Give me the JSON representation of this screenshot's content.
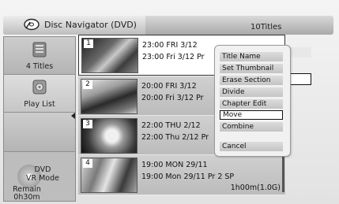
{
  "header": {
    "title": "Disc Navigator (DVD)",
    "count": "10Titles"
  },
  "nav": {
    "titles_label": "4 Titles",
    "playlist_label": "Play List",
    "disc_type": "DVD\nVR Mode",
    "remain_label": "Remain",
    "remain_value": "0h30m"
  },
  "titles": [
    {
      "num": "1",
      "line1": "23:00 FRI 3/12",
      "line2": "23:00 Fri 3/12 Pr",
      "line3": ""
    },
    {
      "num": "2",
      "line1": "20:00 FRI 3/12",
      "line2": "20:00 Fri 3/12 Pr",
      "line3": ""
    },
    {
      "num": "3",
      "line1": "22:00 THU 2/12",
      "line2": "22:00 Thu 2/12 Pr",
      "line3": ""
    },
    {
      "num": "4",
      "line1": "19:00 MON 29/11",
      "line2": "19:00 Mon 29/11 Pr 2 SP",
      "line3": "1h00m(1.0G)"
    }
  ],
  "menu": {
    "items": [
      "Title Name",
      "Set Thumbnail",
      "Erase Section",
      "Divide",
      "Chapter Edit",
      "Move",
      "Combine",
      "Cancel"
    ],
    "selected": "Move"
  }
}
